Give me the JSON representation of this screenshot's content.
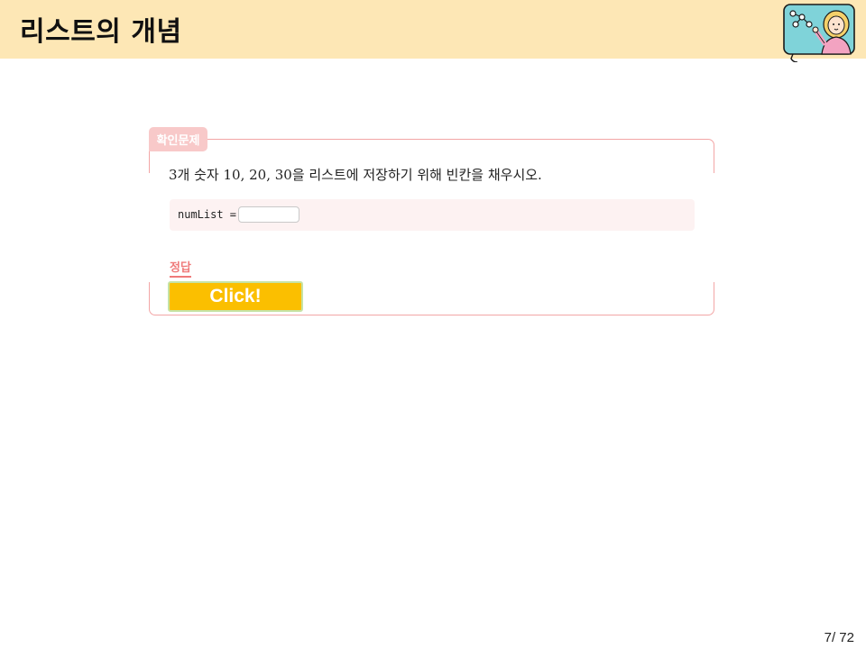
{
  "header": {
    "title": "리스트의 개념",
    "mascot_icon": "teacher-with-network-board-icon",
    "background": "#fde7b5"
  },
  "quiz": {
    "badge": "확인문제",
    "question": "3개 숫자 10, 20, 30을 리스트에 저장하기 위해 빈칸을 채우시오.",
    "code_label": "numList =",
    "input_value": "",
    "answer_label": "정답",
    "click_button": "Click!",
    "accent_color": "#f3a6a6",
    "button_color": "#fbbf00"
  },
  "footer": {
    "page_number": "7/ 72"
  }
}
